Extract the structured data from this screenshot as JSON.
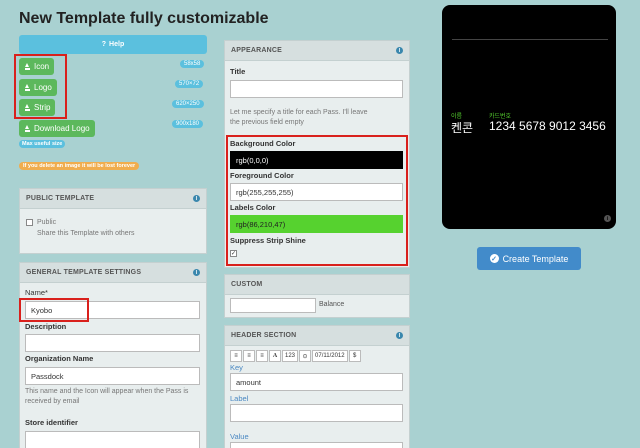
{
  "page": {
    "title": "New Template fully customizable"
  },
  "images": {
    "help_label": "Help",
    "icon_label": "Icon",
    "logo_label": "Logo",
    "strip_label": "Strip",
    "download_logo_label": "Download Logo",
    "icon_size": "58x58",
    "logo_size": "570×72",
    "strip_size": "620×250",
    "download_size": "900x180",
    "max_useful_size": "Max useful size",
    "delete_warning": "If you delete an image it will be lost forever"
  },
  "public_template": {
    "header": "PUBLIC TEMPLATE",
    "checkbox_label": "Public",
    "description": "Share this Template with others"
  },
  "general_settings": {
    "header": "GENERAL TEMPLATE SETTINGS",
    "name_label": "Name*",
    "name_value": "Kyobo",
    "description_label": "Description",
    "description_value": "",
    "org_label": "Organization Name",
    "org_value": "Passdock",
    "org_help": "This name and the Icon will appear when the Pass is received by email",
    "store_label": "Store identifier"
  },
  "appearance": {
    "header": "APPEARANCE",
    "title_label": "Title",
    "title_value": "",
    "title_help": "Let me specify a title for each Pass. I'll leave the previous field empty",
    "bg_label": "Background Color",
    "bg_value": "rgb(0,0,0)",
    "fg_label": "Foreground Color",
    "fg_value": "rgb(255,255,255)",
    "labels_label": "Labels Color",
    "labels_value": "rgb(86,210,47)",
    "suppress_label": "Suppress Strip Shine",
    "colors": {
      "background": "#000000",
      "foreground": "#ffffff",
      "labels": "#56d22f"
    }
  },
  "custom": {
    "header": "CUSTOM",
    "balance_label": "Balance"
  },
  "header_section": {
    "header": "HEADER SECTION",
    "toolbar_num": "123",
    "toolbar_date": "07/11/2012",
    "toolbar_currency": "$",
    "key_label": "Key",
    "key_value": "amount",
    "label_label": "Label",
    "value_label": "Value"
  },
  "preview": {
    "field1_label": "이름",
    "field1_value": "켄콘",
    "field2_label": "카드번호",
    "field2_value": "1234 5678 9012 3456"
  },
  "actions": {
    "create_label": "Create Template"
  }
}
